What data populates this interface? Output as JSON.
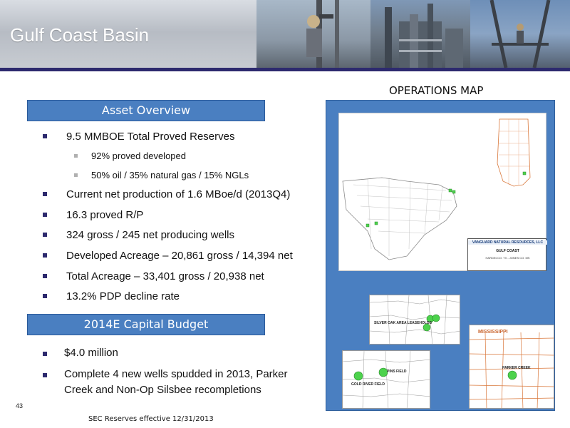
{
  "header": {
    "title": "Gulf Coast Basin"
  },
  "operations_map": {
    "title": "OPERATIONS MAP",
    "legend": {
      "company": "VANGUARD NATURAL RESOURCES, LLC",
      "region": "GULF COAST",
      "location": "HARDIN CO. TX - JONES CO. MS"
    },
    "insets": {
      "texas_east_label": "SILVER OAK AREA LEASEHOLDS",
      "texas_west_label_1": "PINS FIELD",
      "texas_west_label_2": "GOLD RIVER FIELD",
      "mississippi_state": "MISSISSIPPI",
      "mississippi_field": "PARKER CREEK"
    }
  },
  "asset_overview": {
    "heading": "Asset Overview",
    "items": [
      "9.5 MMBOE Total Proved Reserves",
      "92% proved developed",
      "50% oil / 35% natural gas / 15% NGLs",
      "Current net production of 1.6 MBoe/d (2013Q4)",
      "16.3 proved R/P",
      "324 gross / 245 net producing wells",
      "Developed Acreage – 20,861 gross / 14,394 net",
      "Total Acreage – 33,401 gross / 20,938 net",
      "13.2% PDP decline rate"
    ]
  },
  "capital_budget": {
    "heading": "2014E Capital Budget",
    "items": [
      "$4.0 million",
      "Complete 4 new wells spudded in 2013, Parker",
      "Creek and Non-Op Silsbee recompletions"
    ]
  },
  "footer": {
    "slide_number": "43",
    "footnote": "SEC Reserves effective 12/31/2013"
  },
  "colors": {
    "accent_navy": "#2d2a6e",
    "section_blue": "#4a7fc1",
    "map_well_green": "#4cd24c",
    "county_orange": "#d9773a"
  }
}
